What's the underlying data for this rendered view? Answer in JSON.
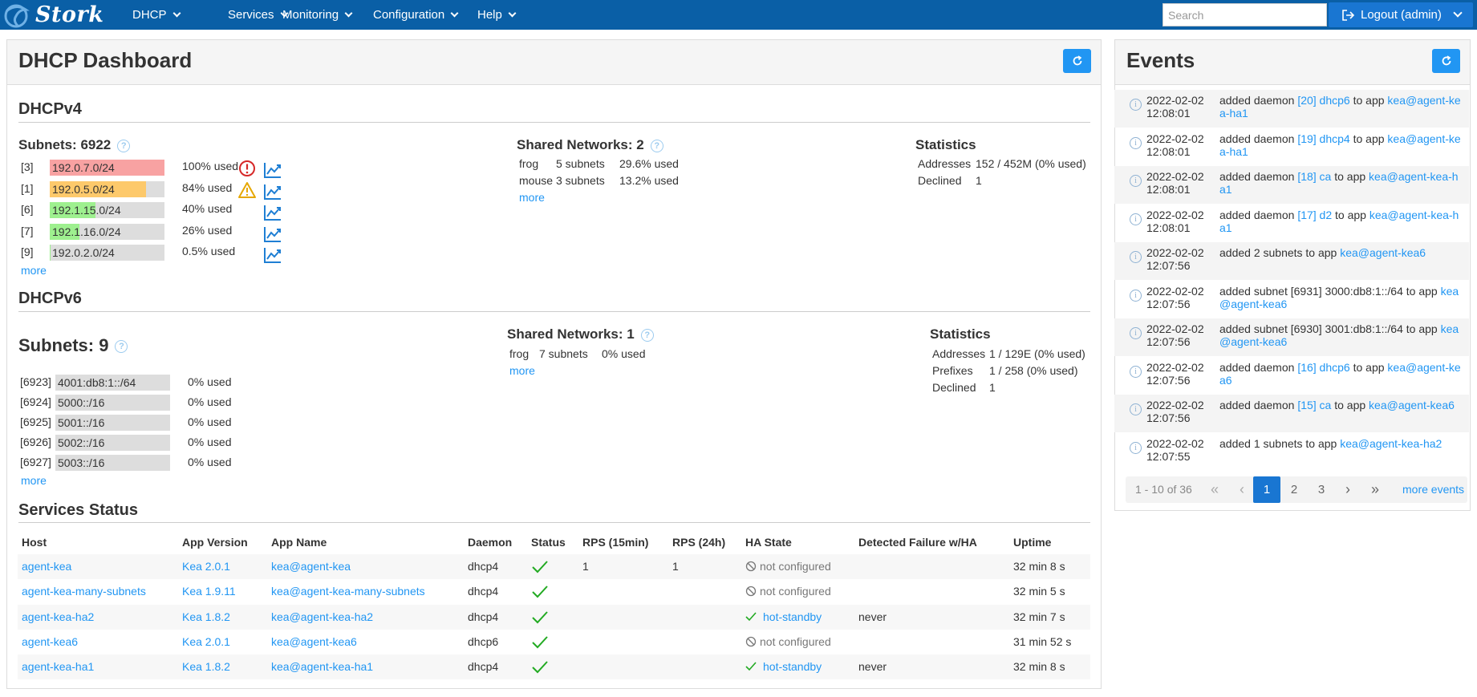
{
  "topbar": {
    "logo": "Stork",
    "menu": [
      {
        "label": "DHCP"
      },
      {
        "label": "Services"
      },
      {
        "label": "Monitoring"
      },
      {
        "label": "Configuration"
      },
      {
        "label": "Help"
      }
    ],
    "search_placeholder": "Search",
    "logout_label": "Logout (admin)"
  },
  "dashboard": {
    "title": "DHCP Dashboard",
    "dhcpv4": {
      "heading": "DHCPv4",
      "subnets_title": "Subnets: 6922",
      "subnets": [
        {
          "id": "[3]",
          "subnet": "192.0.7.0/24",
          "used": "100% used",
          "utilization": 1.0,
          "fill": "#f8a2a2",
          "icon": "error-icon"
        },
        {
          "id": "[1]",
          "subnet": "192.0.5.0/24",
          "used": "84% used",
          "utilization": 0.84,
          "fill": "#fdc96b",
          "icon": "warning-icon"
        },
        {
          "id": "[6]",
          "subnet": "192.1.15.0/24",
          "used": "40% used",
          "utilization": 0.4,
          "fill": "#9ef08f",
          "icon": ""
        },
        {
          "id": "[7]",
          "subnet": "192.1.16.0/24",
          "used": "26% used",
          "utilization": 0.26,
          "fill": "#9ef08f",
          "icon": ""
        },
        {
          "id": "[9]",
          "subnet": "192.0.2.0/24",
          "used": "0.5% used",
          "utilization": 0.005,
          "fill": "#9ef08f",
          "icon": ""
        }
      ],
      "more": "more",
      "shared_title": "Shared Networks: 2",
      "shared": [
        {
          "name": "frog",
          "subnets": "5 subnets",
          "used": "29.6% used"
        },
        {
          "name": "mouse",
          "subnets": "3 subnets",
          "used": "13.2% used"
        }
      ],
      "shared_more": "more",
      "stats_title": "Statistics",
      "stats": [
        {
          "label": "Addresses",
          "value": "152 / 452M (0% used)"
        },
        {
          "label": "Declined",
          "value": "1"
        }
      ]
    },
    "dhcpv6": {
      "heading": "DHCPv6",
      "subnets_title": "Subnets: 9",
      "subnets": [
        {
          "id": "[6923]",
          "subnet": "4001:db8:1::/64",
          "used": "0% used"
        },
        {
          "id": "[6924]",
          "subnet": "5000::/16",
          "used": "0% used"
        },
        {
          "id": "[6925]",
          "subnet": "5001::/16",
          "used": "0% used"
        },
        {
          "id": "[6926]",
          "subnet": "5002::/16",
          "used": "0% used"
        },
        {
          "id": "[6927]",
          "subnet": "5003::/16",
          "used": "0% used"
        }
      ],
      "more": "more",
      "shared_title": "Shared Networks: 1",
      "shared": [
        {
          "name": "frog",
          "subnets": "7 subnets",
          "used": "0% used"
        }
      ],
      "shared_more": "more",
      "stats_title": "Statistics",
      "stats": [
        {
          "label": "Addresses",
          "value": "1 / 129E (0% used)"
        },
        {
          "label": "Prefixes",
          "value": "1 / 258 (0% used)"
        },
        {
          "label": "Declined",
          "value": "1"
        }
      ]
    },
    "services": {
      "heading": "Services Status",
      "columns": [
        "Host",
        "App Version",
        "App Name",
        "Daemon",
        "Status",
        "RPS (15min)",
        "RPS (24h)",
        "HA State",
        "Detected Failure w/HA",
        "Uptime"
      ],
      "rows": [
        {
          "host": "agent-kea",
          "version": "Kea 2.0.1",
          "app": "kea@agent-kea",
          "daemon": "dhcp4",
          "rps15": "1",
          "rps24": "1",
          "ha": "not configured",
          "ha_ok": false,
          "failure": "",
          "uptime": "32 min 8 s"
        },
        {
          "host": "agent-kea-many-subnets",
          "version": "Kea 1.9.11",
          "app": "kea@agent-kea-many-subnets",
          "daemon": "dhcp4",
          "rps15": "",
          "rps24": "",
          "ha": "not configured",
          "ha_ok": false,
          "failure": "",
          "uptime": "32 min 5 s"
        },
        {
          "host": "agent-kea-ha2",
          "version": "Kea 1.8.2",
          "app": "kea@agent-kea-ha2",
          "daemon": "dhcp4",
          "rps15": "",
          "rps24": "",
          "ha": "hot-standby",
          "ha_ok": true,
          "failure": "never",
          "uptime": "32 min 7 s"
        },
        {
          "host": "agent-kea6",
          "version": "Kea 2.0.1",
          "app": "kea@agent-kea6",
          "daemon": "dhcp6",
          "rps15": "",
          "rps24": "",
          "ha": "not configured",
          "ha_ok": false,
          "failure": "",
          "uptime": "31 min 52 s"
        },
        {
          "host": "agent-kea-ha1",
          "version": "Kea 1.8.2",
          "app": "kea@agent-kea-ha1",
          "daemon": "dhcp4",
          "rps15": "",
          "rps24": "",
          "ha": "hot-standby",
          "ha_ok": true,
          "failure": "never",
          "uptime": "32 min 8 s"
        }
      ]
    }
  },
  "events": {
    "title": "Events",
    "items": [
      {
        "time": "2022-02-02 12:08:01",
        "parts": [
          {
            "t": "added daemon "
          },
          {
            "t": "[20] dhcp6",
            "link": true
          },
          {
            "t": " to app "
          },
          {
            "t": "kea@agent-kea-ha1",
            "link": true
          }
        ]
      },
      {
        "time": "2022-02-02 12:08:01",
        "parts": [
          {
            "t": "added daemon "
          },
          {
            "t": "[19] dhcp4",
            "link": true
          },
          {
            "t": " to app "
          },
          {
            "t": "kea@agent-kea-ha1",
            "link": true
          }
        ]
      },
      {
        "time": "2022-02-02 12:08:01",
        "parts": [
          {
            "t": "added daemon "
          },
          {
            "t": "[18] ca",
            "link": true
          },
          {
            "t": " to app "
          },
          {
            "t": "kea@agent-kea-ha1",
            "link": true
          }
        ]
      },
      {
        "time": "2022-02-02 12:08:01",
        "parts": [
          {
            "t": "added daemon "
          },
          {
            "t": "[17] d2",
            "link": true
          },
          {
            "t": " to app "
          },
          {
            "t": "kea@agent-kea-ha1",
            "link": true
          }
        ]
      },
      {
        "time": "2022-02-02 12:07:56",
        "parts": [
          {
            "t": "added 2 subnets to app "
          },
          {
            "t": "kea@agent-kea6",
            "link": true
          }
        ]
      },
      {
        "time": "2022-02-02 12:07:56",
        "parts": [
          {
            "t": "added subnet [6931] 3000:db8:1::/64 to app "
          },
          {
            "t": "kea@agent-kea6",
            "link": true
          }
        ]
      },
      {
        "time": "2022-02-02 12:07:56",
        "parts": [
          {
            "t": "added subnet [6930] 3001:db8:1::/64 to app "
          },
          {
            "t": "kea@agent-kea6",
            "link": true
          }
        ]
      },
      {
        "time": "2022-02-02 12:07:56",
        "parts": [
          {
            "t": "added daemon "
          },
          {
            "t": "[16] dhcp6",
            "link": true
          },
          {
            "t": " to app "
          },
          {
            "t": "kea@agent-kea6",
            "link": true
          }
        ]
      },
      {
        "time": "2022-02-02 12:07:56",
        "parts": [
          {
            "t": "added daemon "
          },
          {
            "t": "[15] ca",
            "link": true
          },
          {
            "t": " to app "
          },
          {
            "t": "kea@agent-kea6",
            "link": true
          }
        ]
      },
      {
        "time": "2022-02-02 12:07:55",
        "parts": [
          {
            "t": "added 1 subnets to app "
          },
          {
            "t": "kea@agent-kea-ha2",
            "link": true
          }
        ]
      }
    ],
    "pager": {
      "summary": "1 - 10 of 36",
      "pages": [
        "1",
        "2",
        "3"
      ],
      "current": "1",
      "first": "«",
      "prev": "‹",
      "next": "›",
      "last": "»",
      "more_events": "more events"
    }
  },
  "colors": {
    "topbar": "#0a5fa6",
    "accent": "#2196f3",
    "link": "#2196f3",
    "ok": "#22aa22",
    "error": "#d62828",
    "warning": "#e6a700"
  }
}
